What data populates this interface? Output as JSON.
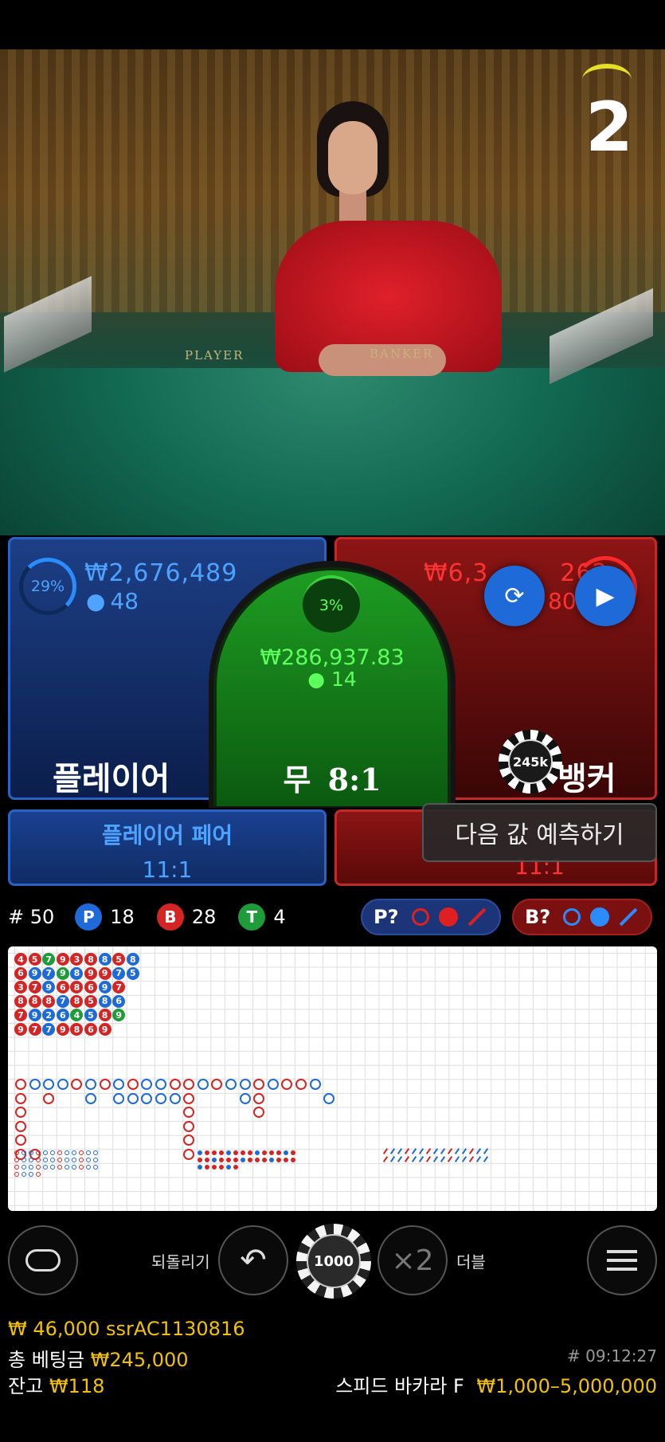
{
  "video": {
    "round_countdown": "2",
    "felt_player": "PLAYER",
    "felt_banker": "BANKER"
  },
  "player": {
    "percent": "29%",
    "amount": "₩2,676,489",
    "players": "48",
    "label": "플레이어",
    "percent_value": 29
  },
  "banker": {
    "amount": "₩6,3",
    "amount_tail": "262",
    "players_tail": "80",
    "label": "뱅커",
    "chip_label": "245k"
  },
  "tie": {
    "percent": "3%",
    "amount": "₩286,937.83",
    "players": "14",
    "label": "무",
    "payout": "8:1"
  },
  "player_pair": {
    "label": "플레이어 페어",
    "payout": "11:1"
  },
  "banker_pair": {
    "payout": "11:1"
  },
  "tooltip": "다음 값 예측하기",
  "stats": {
    "round_label": "# 50",
    "p_letter": "P",
    "p_count": "18",
    "b_letter": "B",
    "b_count": "28",
    "t_letter": "T",
    "t_count": "4",
    "p_predict": "P?",
    "b_predict": "B?"
  },
  "controls": {
    "undo_label": "되돌리기",
    "chip_value": "1000",
    "double_symbol": "×2",
    "double_label": "더블"
  },
  "footer": {
    "win_line": "₩ 46,000 ssrAC1130816",
    "total_bet_label": "총 베팅금",
    "total_bet_value": "₩245,000",
    "balance_label": "잔고",
    "balance_value": "₩118",
    "game_id": "# 09:12:27",
    "table_name": "스피드 바카라 F",
    "limits": "₩1,000–5,000,000"
  },
  "colors": {
    "player": "#1d6ad8",
    "banker": "#d42424",
    "tie": "#1e9c3a",
    "gold": "#f2c200"
  },
  "bead_road": [
    [
      "4",
      "5",
      "7",
      "9",
      "3",
      "8",
      "8",
      "5",
      "8"
    ],
    [
      "6",
      "9",
      "7",
      "9",
      "8",
      "9",
      "9",
      "7",
      "5"
    ],
    [
      "3",
      "7",
      "9",
      "6",
      "8",
      "6",
      "9",
      "7"
    ],
    [
      "8",
      "8",
      "8",
      "7",
      "8",
      "5",
      "8",
      "6"
    ],
    [
      "7",
      "9",
      "2",
      "6",
      "4",
      "5",
      "8",
      "9"
    ],
    [
      "9",
      "7",
      "7",
      "9",
      "8",
      "6",
      "9"
    ]
  ],
  "bead_colors": [
    [
      "B",
      "B",
      "T",
      "B",
      "B",
      "B",
      "P",
      "B",
      "P"
    ],
    [
      "B",
      "P",
      "P",
      "T",
      "P",
      "B",
      "B",
      "P",
      "P"
    ],
    [
      "B",
      "B",
      "P",
      "B",
      "B",
      "B",
      "P",
      "B"
    ],
    [
      "B",
      "B",
      "B",
      "P",
      "B",
      "B",
      "P",
      "P"
    ],
    [
      "B",
      "P",
      "P",
      "P",
      "T",
      "P",
      "B",
      "T"
    ],
    [
      "B",
      "B",
      "P",
      "B",
      "B",
      "B",
      "B"
    ]
  ]
}
